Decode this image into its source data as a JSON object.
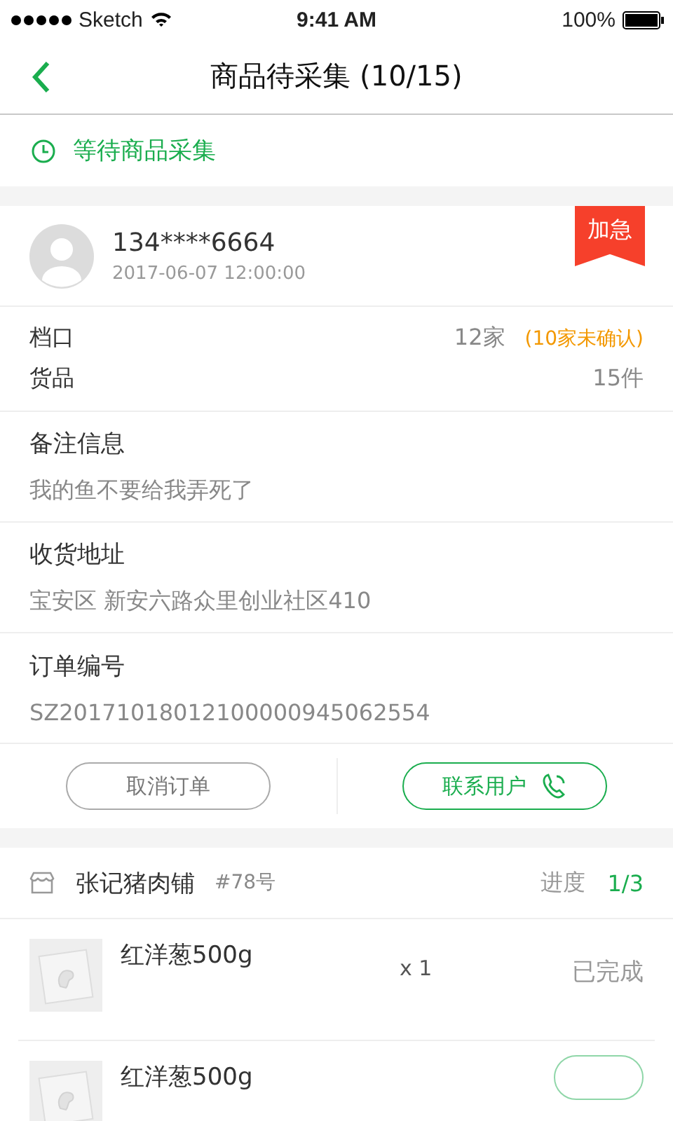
{
  "status_bar": {
    "carrier": "Sketch",
    "time": "9:41 AM",
    "battery": "100%"
  },
  "nav": {
    "title": "商品待采集 (10/15)"
  },
  "status_banner": {
    "text": "等待商品采集"
  },
  "customer": {
    "phone": "134****6664",
    "time": "2017-06-07 12:00:00",
    "urgent": true,
    "urgent_label": "加急"
  },
  "summary": [
    {
      "label": "档口",
      "value": "12家",
      "note": "(10家未确认)"
    },
    {
      "label": "货品",
      "value": "15件"
    }
  ],
  "sections": [
    {
      "label": "备注信息",
      "value": "我的鱼不要给我弄死了"
    },
    {
      "label": "收货地址",
      "value": "宝安区 新安六路众里创业社区410"
    },
    {
      "label": "订单编号",
      "value": "SZ20171018012100000945062554"
    }
  ],
  "actions": [
    {
      "label": "取消订单",
      "kind": "plain"
    },
    {
      "label": "联系用户",
      "kind": "call"
    }
  ],
  "shop": {
    "name": "张记猪肉铺",
    "number": "#78号",
    "progress_label": "进度",
    "progress": "1/3"
  },
  "items": [
    {
      "name": "红洋葱500g",
      "qty": "x 1",
      "status": "已完成",
      "kind": "done"
    },
    {
      "name": "红洋葱500g",
      "kind": "action"
    }
  ]
}
